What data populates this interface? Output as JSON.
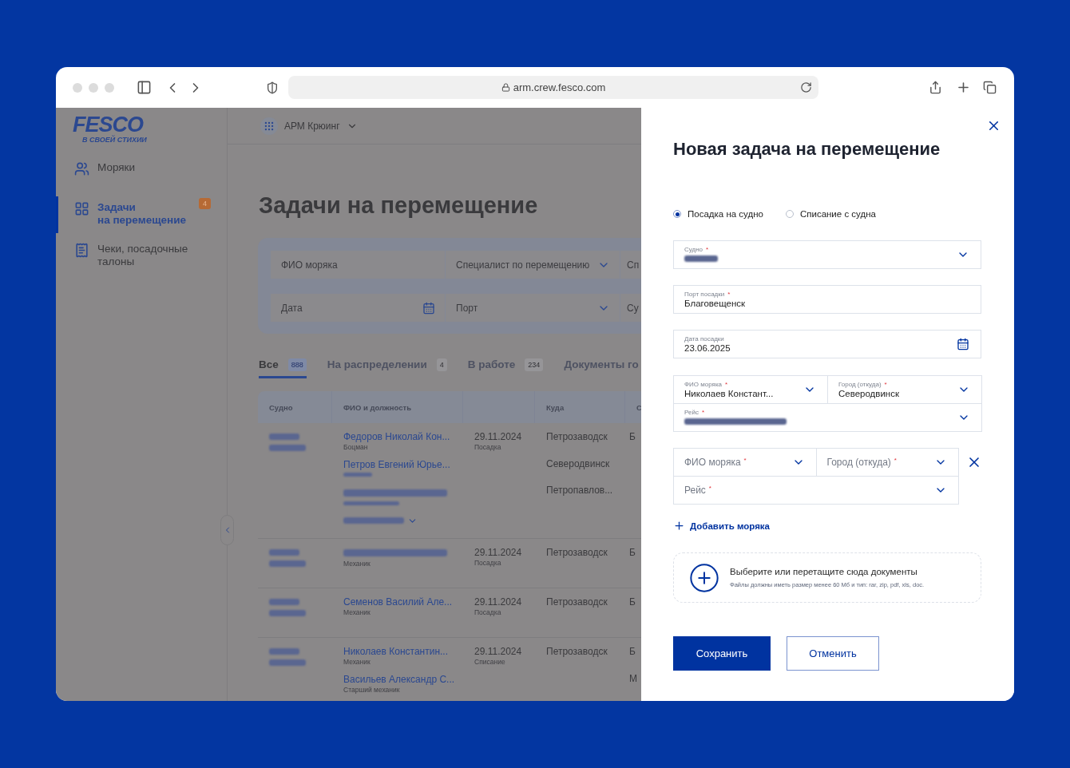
{
  "browser": {
    "url": "arm.crew.fesco.com"
  },
  "sidebar": {
    "logo": "FESCO",
    "tagline": "В СВОЕЙ СТИХИИ",
    "items": [
      {
        "label": "Моряки",
        "selected": false
      },
      {
        "label": "Задачи\nна перемещение",
        "selected": true,
        "badge": "4"
      },
      {
        "label": "Чеки, посадочные\nталоны",
        "selected": false
      }
    ]
  },
  "topbar": {
    "app": "АРМ Крюинг"
  },
  "page": {
    "title": "Задачи на перемещение"
  },
  "filters": [
    {
      "placeholder": "ФИО моряка",
      "kind": "text"
    },
    {
      "placeholder": "Специалист по перемещению",
      "kind": "select"
    },
    {
      "placeholder": "Сп",
      "kind": "text"
    },
    {
      "placeholder": "Дата",
      "kind": "date"
    },
    {
      "placeholder": "Порт",
      "kind": "select"
    },
    {
      "placeholder": "Су",
      "kind": "text"
    }
  ],
  "tabs": [
    {
      "label": "Все",
      "count": "888",
      "selected": true
    },
    {
      "label": "На распределении",
      "count": "4",
      "selected": false
    },
    {
      "label": "В работе",
      "count": "234",
      "selected": false
    },
    {
      "label": "Документы го",
      "selected": false
    }
  ],
  "table": {
    "columns": [
      {
        "kind": "label",
        "label": "Судно"
      },
      {
        "kind": "label",
        "label": "ФИО и должность"
      },
      {
        "kind": "blank"
      },
      {
        "kind": "label",
        "label": "Куда"
      },
      {
        "kind": "label",
        "label": "С"
      }
    ],
    "rows": [
      {
        "ship_redacted": true,
        "crew": [
          {
            "name": "Федоров Николай Кон...",
            "position": "Боцман"
          },
          {
            "name": "Петров Евгений Юрье...",
            "position_redacted": true
          },
          {
            "name_redacted": true,
            "position_redacted": true
          }
        ],
        "more_redacted": true,
        "date": "29.11.2024",
        "type": "Посадка",
        "destinations": [
          "Петрозаводск",
          "Северодвинск",
          "Петропавлов..."
        ],
        "column_5": [
          "Б"
        ]
      },
      {
        "ship_redacted": true,
        "crew": [
          {
            "name_redacted": true,
            "position": "Механик"
          }
        ],
        "date": "29.11.2024",
        "type": "Посадка",
        "destinations": [
          "Петрозаводск"
        ],
        "column_5": [
          "Б"
        ]
      },
      {
        "ship_redacted": true,
        "crew": [
          {
            "name": "Семенов Василий Але...",
            "position": "Механик"
          }
        ],
        "date": "29.11.2024",
        "type": "Посадка",
        "destinations": [
          "Петрозаводск"
        ],
        "column_5": [
          "Б"
        ]
      },
      {
        "ship_redacted": true,
        "crew": [
          {
            "name": "Николаев Константин...",
            "position": "Механик"
          },
          {
            "name": "Васильев Александр С...",
            "position": "Старший механик"
          }
        ],
        "date": "29.11.2024",
        "type": "Списание",
        "destinations": [
          "Петрозаводск"
        ],
        "column_5": [
          "Б",
          "М"
        ]
      }
    ]
  },
  "required_mark": "*",
  "drawer": {
    "title": "Новая задача на перемещение",
    "radios": [
      {
        "label": "Посадка на судно",
        "selected": true
      },
      {
        "label": "Списание с судна",
        "selected": false
      }
    ],
    "fields": [
      {
        "label": "Судно",
        "required": true,
        "value_redacted": true,
        "kind": "select"
      },
      {
        "label": "Порт посадки",
        "required": true,
        "value": "Благовещенск",
        "kind": "text"
      },
      {
        "label": "Дата посадки",
        "required": false,
        "value": "23.06.2025",
        "kind": "date"
      }
    ],
    "seamen": [
      {
        "removable": false,
        "fields": [
          {
            "label": "ФИО моряка",
            "required": true,
            "value": "Николаев Констант...",
            "kind": "select"
          },
          {
            "label": "Город (откуда)",
            "required": true,
            "value": "Северодвинск",
            "kind": "select"
          },
          {
            "label": "Рейс",
            "required": true,
            "value_redacted": true,
            "kind": "select"
          }
        ]
      },
      {
        "removable": true,
        "fields": [
          {
            "label": "ФИО моряка",
            "required": true,
            "kind": "select"
          },
          {
            "label": "Город (откуда)",
            "required": true,
            "kind": "select"
          },
          {
            "label": "Рейс",
            "required": true,
            "kind": "select"
          }
        ]
      }
    ],
    "add_seaman": "Добавить моряка",
    "upload": {
      "title": "Выберите или перетащите сюда документы",
      "hint": "Файлы должны иметь размер менее 60 Мб и тип: rar, zip, pdf, xls, doc."
    },
    "buttons": [
      {
        "label": "Сохранить",
        "kind": "primary"
      },
      {
        "label": "Отменить",
        "kind": "secondary"
      }
    ]
  }
}
